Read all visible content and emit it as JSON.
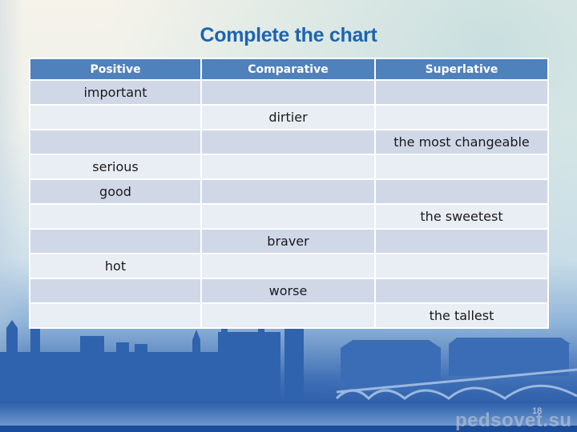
{
  "slide": {
    "title": "Complete the chart",
    "page_number": "18",
    "watermark": "pedsovet.su"
  },
  "table": {
    "headers": [
      "Positive",
      "Comparative",
      "Superlative"
    ],
    "rows": [
      [
        "important",
        "",
        ""
      ],
      [
        "",
        "dirtier",
        ""
      ],
      [
        "",
        "",
        "the most changeable"
      ],
      [
        "serious",
        "",
        ""
      ],
      [
        "good",
        "",
        ""
      ],
      [
        "",
        "",
        "the sweetest"
      ],
      [
        "",
        "braver",
        ""
      ],
      [
        "hot",
        "",
        ""
      ],
      [
        "",
        "worse",
        ""
      ],
      [
        "",
        "",
        "the tallest"
      ]
    ]
  },
  "colors": {
    "title": "#1d64b0",
    "header_bg": "#4f81bd",
    "row_odd_bg": "#d0d8e8",
    "row_even_bg": "#e9edf4"
  }
}
